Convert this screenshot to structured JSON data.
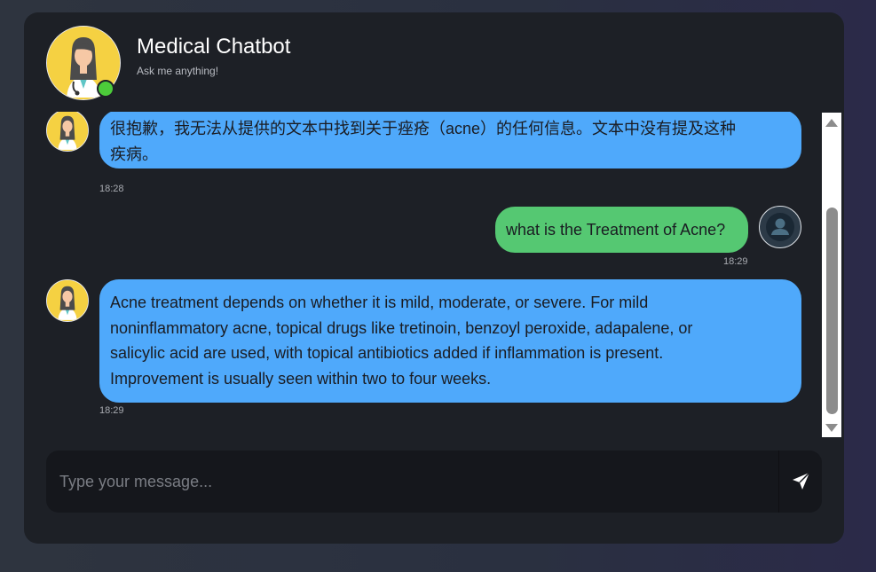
{
  "header": {
    "title": "Medical Chatbot",
    "subtitle": "Ask me anything!"
  },
  "messages": [
    {
      "sender": "bot",
      "lines": [
        "很抱歉，我无法从提供的文本中找到关于痤疮（acne）的任何信息。文本中没有提及这种",
        "疾病。"
      ],
      "time": "18:28"
    },
    {
      "sender": "user",
      "lines": [
        "what is the Treatment of Acne?"
      ],
      "time": "18:29"
    },
    {
      "sender": "bot",
      "lines": [
        "Acne treatment depends on whether it is mild, moderate, or severe. For mild",
        "noninflammatory acne, topical drugs like tretinoin, benzoyl peroxide, adapalene, or",
        "salicylic acid are used, with topical antibiotics added if inflammation is present.",
        "Improvement is usually seen within two to four weeks."
      ],
      "time": "18:29"
    }
  ],
  "input": {
    "placeholder": "Type your message...",
    "value": ""
  },
  "icons": {
    "bot_avatar": "doctor-avatar-icon",
    "user_avatar": "user-avatar-icon",
    "send": "send-arrow-icon",
    "online": "online-status-dot"
  },
  "colors": {
    "bot_bubble": "#4fa9fb",
    "user_bubble": "#55c872",
    "online": "#4ccb3a",
    "card_bg": "#1d2026"
  }
}
